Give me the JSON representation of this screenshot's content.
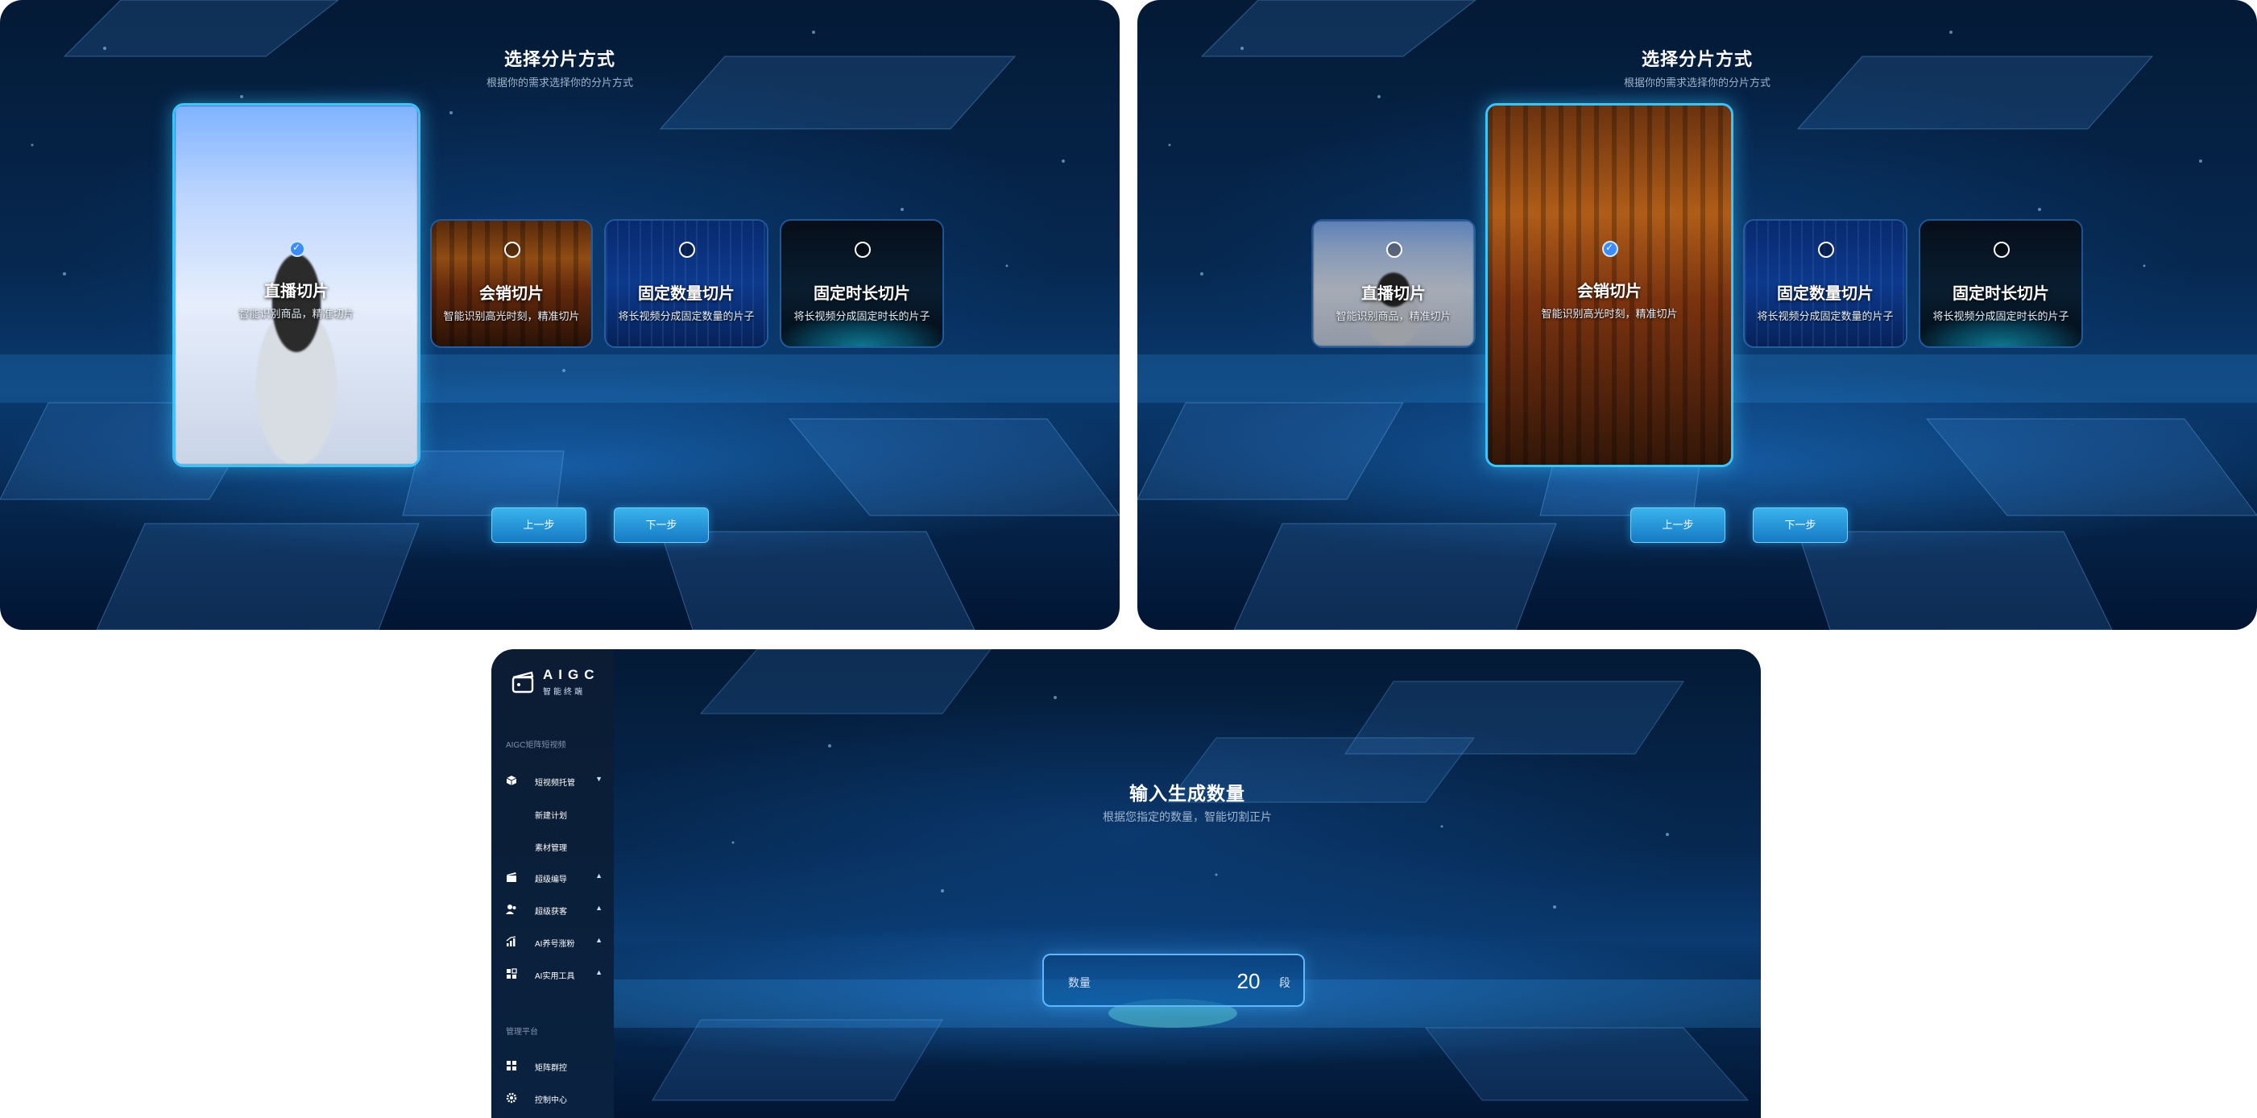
{
  "colors": {
    "accent": "#39c6ff",
    "button_gradient_top": "#3ab4ee",
    "button_gradient_bottom": "#1679c4",
    "background_deep": "#041a36",
    "radio_checked": "#3b8cff"
  },
  "step_select": {
    "title": "选择分片方式",
    "subtitle": "根据你的需求选择你的分片方式",
    "options": [
      {
        "label": "直播切片",
        "desc": "智能识别商品，精准切片",
        "icon": "live-stream"
      },
      {
        "label": "会销切片",
        "desc": "智能识别高光时刻，精准切片",
        "icon": "conference-hall"
      },
      {
        "label": "固定数量切片",
        "desc": "将长视频分成固定数量的片子",
        "icon": "data-stream"
      },
      {
        "label": "固定时长切片",
        "desc": "将长视频分成固定时长的片子",
        "icon": "earth-orbit"
      }
    ],
    "prev_label": "上一步",
    "next_label": "下一步"
  },
  "screens": [
    {
      "selected_option": "直播切片"
    },
    {
      "selected_option": "会销切片"
    }
  ],
  "app": {
    "logo_title": "AIGC",
    "logo_subtitle": "智能终端",
    "sidebar": {
      "section_1": "AIGC矩阵短视频",
      "items": [
        {
          "label": "短视频托管",
          "icon": "cube-icon",
          "expanded": true,
          "children": [
            "新建计划",
            "素材管理"
          ]
        },
        {
          "label": "超级编导",
          "icon": "clapperboard-icon",
          "expanded": false
        },
        {
          "label": "超级获客",
          "icon": "users-icon",
          "expanded": false
        },
        {
          "label": "AI养号涨粉",
          "icon": "chart-icon",
          "expanded": false
        },
        {
          "label": "AI实用工具",
          "icon": "apps-icon",
          "expanded": false
        }
      ],
      "section_2": "管理平台",
      "management": [
        {
          "label": "矩阵群控",
          "icon": "grid-icon"
        },
        {
          "label": "控制中心",
          "icon": "gear-icon"
        }
      ]
    },
    "input_step": {
      "title": "输入生成数量",
      "subtitle": "根据您指定的数量，智能切割正片",
      "field_label": "数量",
      "value": "20",
      "unit": "段"
    }
  }
}
